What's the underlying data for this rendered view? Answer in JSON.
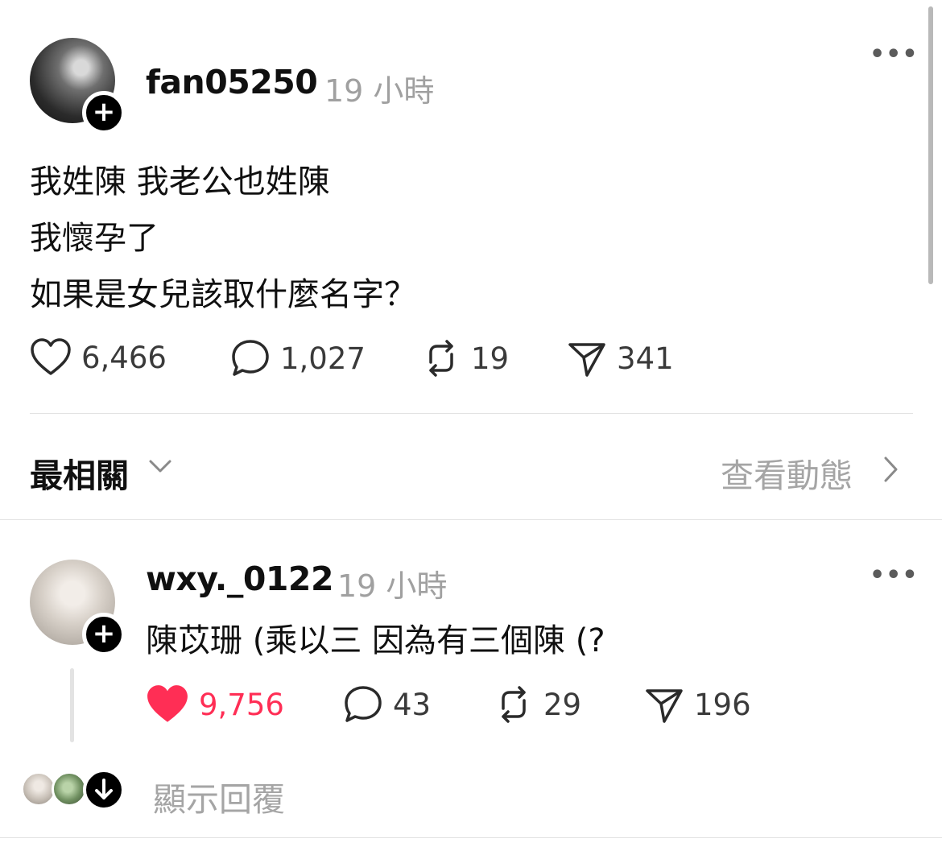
{
  "post": {
    "username": "fan05250",
    "time": "19 小時",
    "more_icon": "more-dots-icon",
    "lines": [
      "我姓陳 我老公也姓陳",
      "我懷孕了",
      "如果是女兒該取什麼名字？"
    ],
    "likes": "6,466",
    "comments": "1,027",
    "reposts": "19",
    "shares": "341"
  },
  "sort": {
    "label": "最相關",
    "view_activity": "查看動態"
  },
  "reply": {
    "username": "wxy._0122",
    "time": "19 小時",
    "text": "陳苡珊 (乘以三 因為有三個陳 (?",
    "likes": "9,756",
    "liked": true,
    "comments": "43",
    "reposts": "29",
    "shares": "196",
    "show_replies": "顯示回覆"
  },
  "colors": {
    "liked": "#ff2e55",
    "muted": "#a0a0a0",
    "text": "#101010"
  }
}
